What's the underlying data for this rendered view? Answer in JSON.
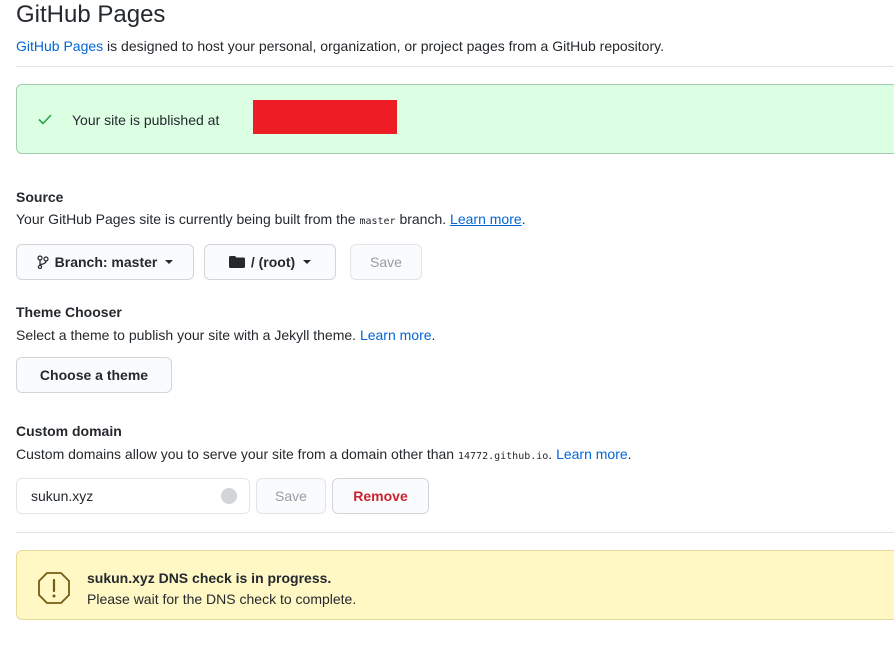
{
  "header": {
    "title": "GitHub Pages",
    "intro_link": "GitHub Pages",
    "intro_rest": " is designed to host your personal, organization, or project pages from a GitHub repository."
  },
  "published": {
    "text": "Your site is published at",
    "icon": "check-icon",
    "redaction_color": "#ee1c25"
  },
  "source": {
    "heading": "Source",
    "text_before": "Your GitHub Pages site is currently being built from the ",
    "code": "master",
    "text_after": " branch. ",
    "learn_more": "Learn more",
    "end": ".",
    "branch_button": "Branch: master",
    "folder_button": "/ (root)",
    "save_button": "Save"
  },
  "theme": {
    "heading": "Theme Chooser",
    "text": "Select a theme to publish your site with a Jekyll theme. ",
    "learn_more": "Learn more",
    "end": ".",
    "button": "Choose a theme"
  },
  "custom_domain": {
    "heading": "Custom domain",
    "text": "Custom domains allow you to serve your site from a domain other than ",
    "code": "14772.github.io",
    "end_sep": ". ",
    "learn_more": "Learn more",
    "end": ".",
    "input_value": "sukun.xyz",
    "save_button": "Save",
    "remove_button": "Remove"
  },
  "dns_warning": {
    "title": "sukun.xyz DNS check is in progress.",
    "subtitle": "Please wait for the DNS check to complete.",
    "icon": "alert-icon"
  }
}
